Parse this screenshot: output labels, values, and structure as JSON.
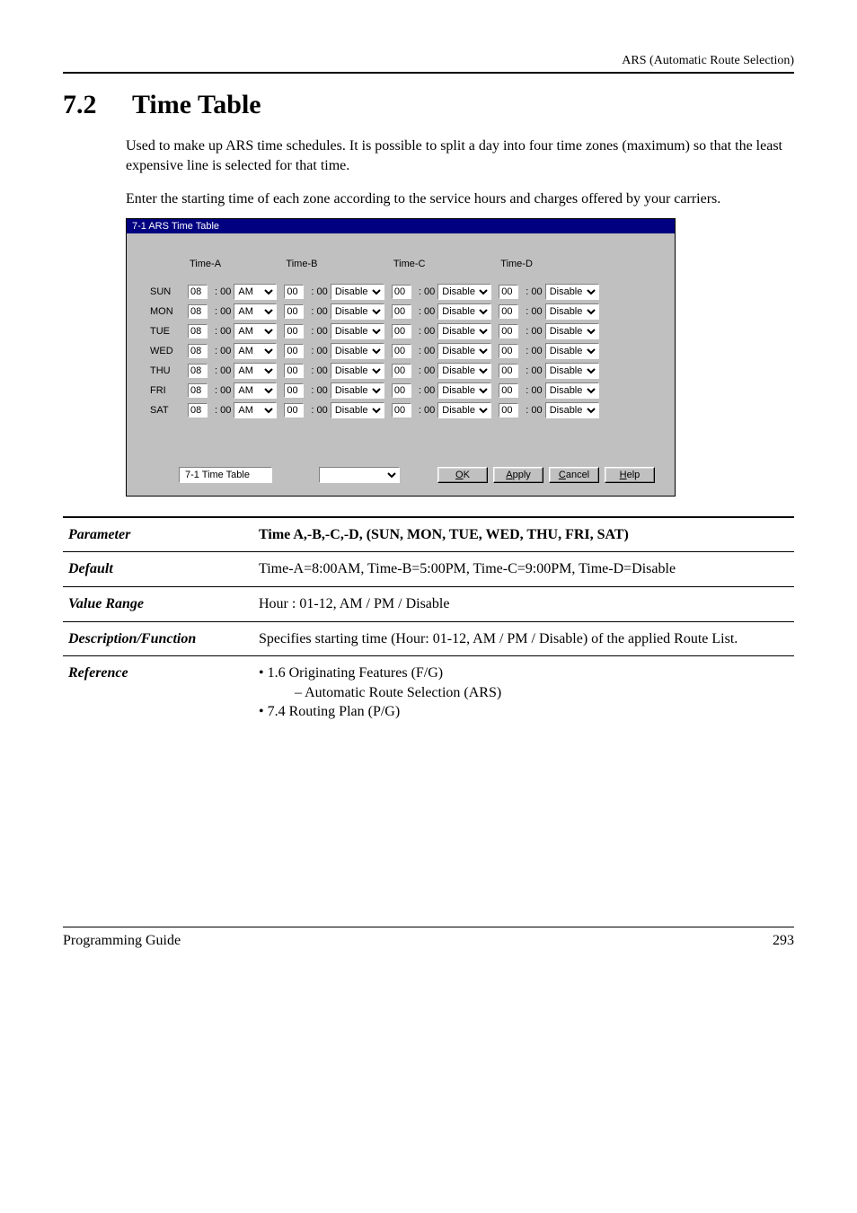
{
  "header": {
    "right": "ARS (Automatic Route Selection)"
  },
  "section": {
    "number": "7.2",
    "title": "Time Table"
  },
  "intro": {
    "p1": "Used to make up ARS time schedules. It is possible to split a day into four time zones (maximum) so that the least expensive line is selected for that time.",
    "p2": "Enter the starting time of each zone according to the service hours and charges offered by your carriers."
  },
  "win": {
    "title": "7-1 ARS Time Table",
    "cols": {
      "a": "Time-A",
      "b": "Time-B",
      "c": "Time-C",
      "d": "Time-D"
    },
    "minLabelA": ": 00",
    "minLabelOther": ": 00",
    "days": [
      "SUN",
      "MON",
      "TUE",
      "WED",
      "THU",
      "FRI",
      "SAT"
    ],
    "rows": [
      {
        "a_h": "08",
        "a_ampm": "AM",
        "b_h": "00",
        "b_dis": "Disable",
        "c_h": "00",
        "c_dis": "Disable",
        "d_h": "00",
        "d_dis": "Disable"
      },
      {
        "a_h": "08",
        "a_ampm": "AM",
        "b_h": "00",
        "b_dis": "Disable",
        "c_h": "00",
        "c_dis": "Disable",
        "d_h": "00",
        "d_dis": "Disable"
      },
      {
        "a_h": "08",
        "a_ampm": "AM",
        "b_h": "00",
        "b_dis": "Disable",
        "c_h": "00",
        "c_dis": "Disable",
        "d_h": "00",
        "d_dis": "Disable"
      },
      {
        "a_h": "08",
        "a_ampm": "AM",
        "b_h": "00",
        "b_dis": "Disable",
        "c_h": "00",
        "c_dis": "Disable",
        "d_h": "00",
        "d_dis": "Disable"
      },
      {
        "a_h": "08",
        "a_ampm": "AM",
        "b_h": "00",
        "b_dis": "Disable",
        "c_h": "00",
        "c_dis": "Disable",
        "d_h": "00",
        "d_dis": "Disable"
      },
      {
        "a_h": "08",
        "a_ampm": "AM",
        "b_h": "00",
        "b_dis": "Disable",
        "c_h": "00",
        "c_dis": "Disable",
        "d_h": "00",
        "d_dis": "Disable"
      },
      {
        "a_h": "08",
        "a_ampm": "AM",
        "b_h": "00",
        "b_dis": "Disable",
        "c_h": "00",
        "c_dis": "Disable",
        "d_h": "00",
        "d_dis": "Disable"
      }
    ],
    "nameField": "7-1 Time Table",
    "buttons": {
      "ok": "OK",
      "apply": "Apply",
      "cancel": "Cancel",
      "help": "Help"
    }
  },
  "params": {
    "hdr_param": "Parameter",
    "hdr_val": "Time A,-B,-C,-D, (SUN, MON, TUE, WED, THU, FRI, SAT)",
    "default_lbl": "Default",
    "default_val": "Time-A=8:00AM, Time-B=5:00PM, Time-C=9:00PM, Time-D=Disable",
    "vr_lbl": "Value Range",
    "vr_val": "Hour : 01-12, AM / PM / Disable",
    "df_lbl": "Description/Function",
    "df_val": "Specifies starting time (Hour: 01-12, AM / PM / Disable) of the applied Route List.",
    "ref_lbl": "Reference",
    "ref_l1": "• 1.6 Originating Features (F/G)",
    "ref_l2": "– Automatic Route Selection (ARS)",
    "ref_l3": "• 7.4   Routing Plan (P/G)"
  },
  "footer": {
    "left": "Programming Guide",
    "right": "293"
  }
}
